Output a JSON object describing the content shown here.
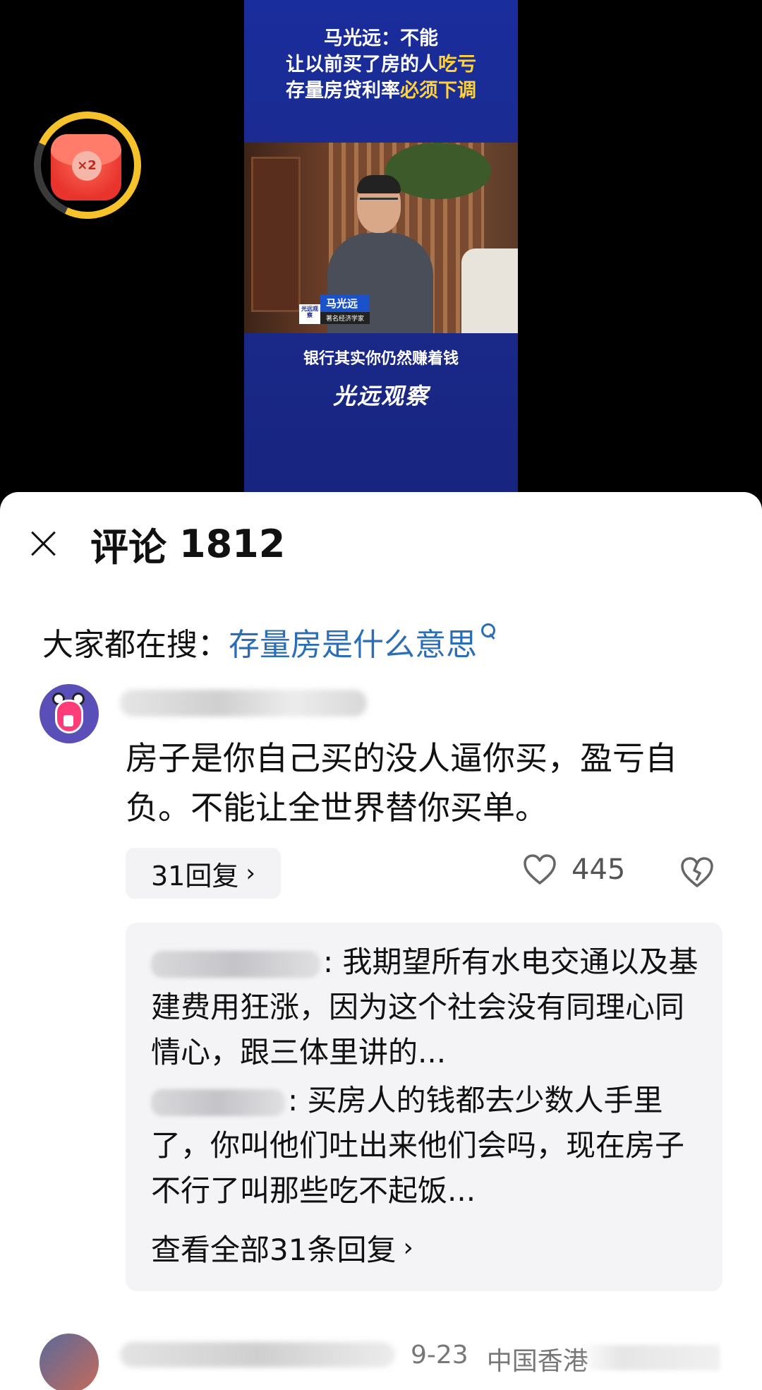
{
  "video": {
    "headline_line1": "马光远：不能",
    "headline_line2_prefix": "让以前买了房的人",
    "headline_line2_highlight": "吃亏",
    "headline_line3_prefix": "存量房贷利率",
    "headline_line3_highlight": "必须下调",
    "speaker_name": "马光远",
    "speaker_title": "著名经济学家",
    "speaker_logo_text": "光远观察",
    "tagline": "银行其实你仍然赚着钱",
    "brand": "光远观察",
    "colors": {
      "frame_bg": "#1b2a8e",
      "highlight": "#ffd23a"
    }
  },
  "reward_badge": {
    "multiplier": "×2",
    "icon": "red-packet-icon",
    "ring_color": "#f5c22b"
  },
  "comments_panel": {
    "title": "评论",
    "count": "1812",
    "trending_label": "大家都在搜：",
    "trending_query": "存量房是什么意思",
    "trending_color": "#2a6eb8"
  },
  "comment_1": {
    "text": "房子是你自己买的没人逼你买，盈亏自负。不能让全世界替你买单。",
    "reply_count_label": "31回复",
    "likes": "445",
    "replies": [
      {
        "suffix": ": 我期望所有水电交通以及基建费用狂涨，因为这个社会没有同理心同情心，跟三体里讲的..."
      },
      {
        "suffix": ": 买房人的钱都去少数人手里了，你叫他们吐出来他们会吗，现在房子不行了叫那些吃不起饭..."
      }
    ],
    "view_all_label": "查看全部31条回复"
  },
  "comment_2": {
    "date": "9-23",
    "location": "中国香港"
  }
}
